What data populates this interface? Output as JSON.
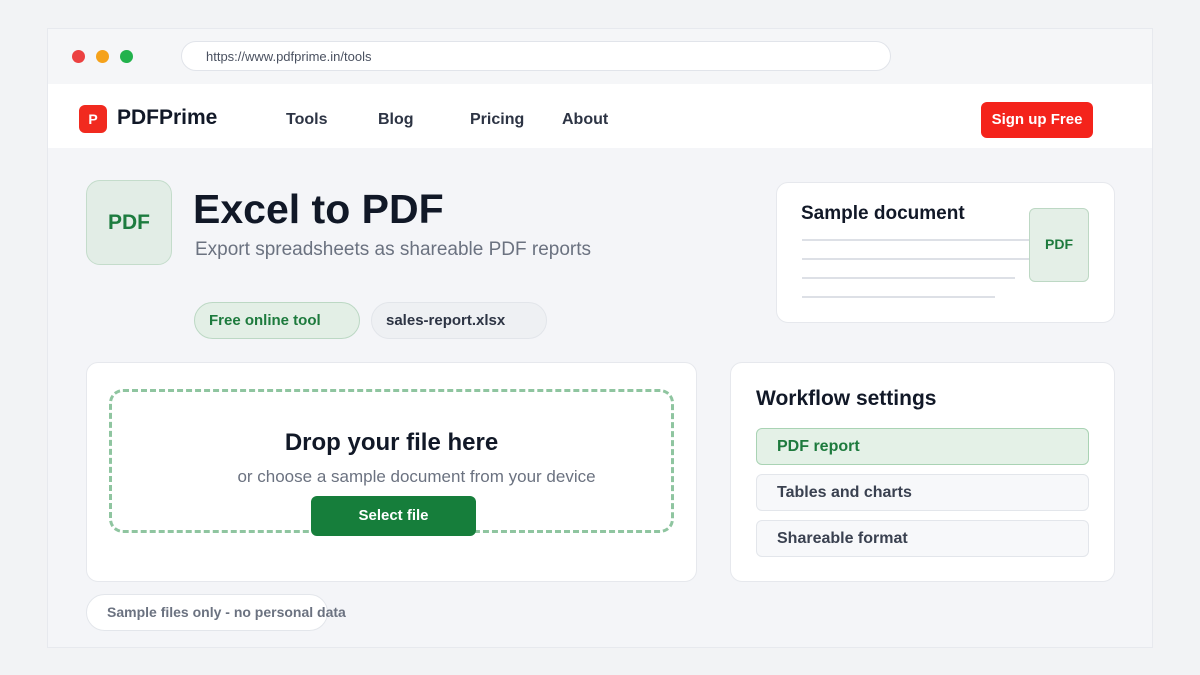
{
  "browser": {
    "url": "https://www.pdfprime.in/tools"
  },
  "navbar": {
    "logo_mark": "P",
    "brand": "PDFPrime",
    "items": [
      {
        "label": "Tools"
      },
      {
        "label": "Blog"
      },
      {
        "label": "Pricing"
      },
      {
        "label": "About"
      }
    ],
    "signup_label": "Sign up Free"
  },
  "hero": {
    "icon_label": "PDF",
    "title": "Excel to PDF",
    "subtitle": "Export spreadsheets as shareable PDF reports",
    "tags": [
      "Free online tool",
      "sales-report.xlsx"
    ]
  },
  "sample": {
    "title": "Sample document",
    "badge": "PDF"
  },
  "dropzone": {
    "title": "Drop your file here",
    "subtitle": "or choose a sample document from your device",
    "button_label": "Select file"
  },
  "settings": {
    "title": "Workflow settings",
    "options": [
      {
        "label": "PDF report",
        "selected": true
      },
      {
        "label": "Tables and charts",
        "selected": false
      },
      {
        "label": "Shareable format",
        "selected": false
      }
    ]
  },
  "footer": {
    "note": "Sample files only - no personal data"
  },
  "colors": {
    "brand_red": "#f4231b",
    "accent_green": "#167e3b",
    "light_green": "#e4f1e7"
  }
}
